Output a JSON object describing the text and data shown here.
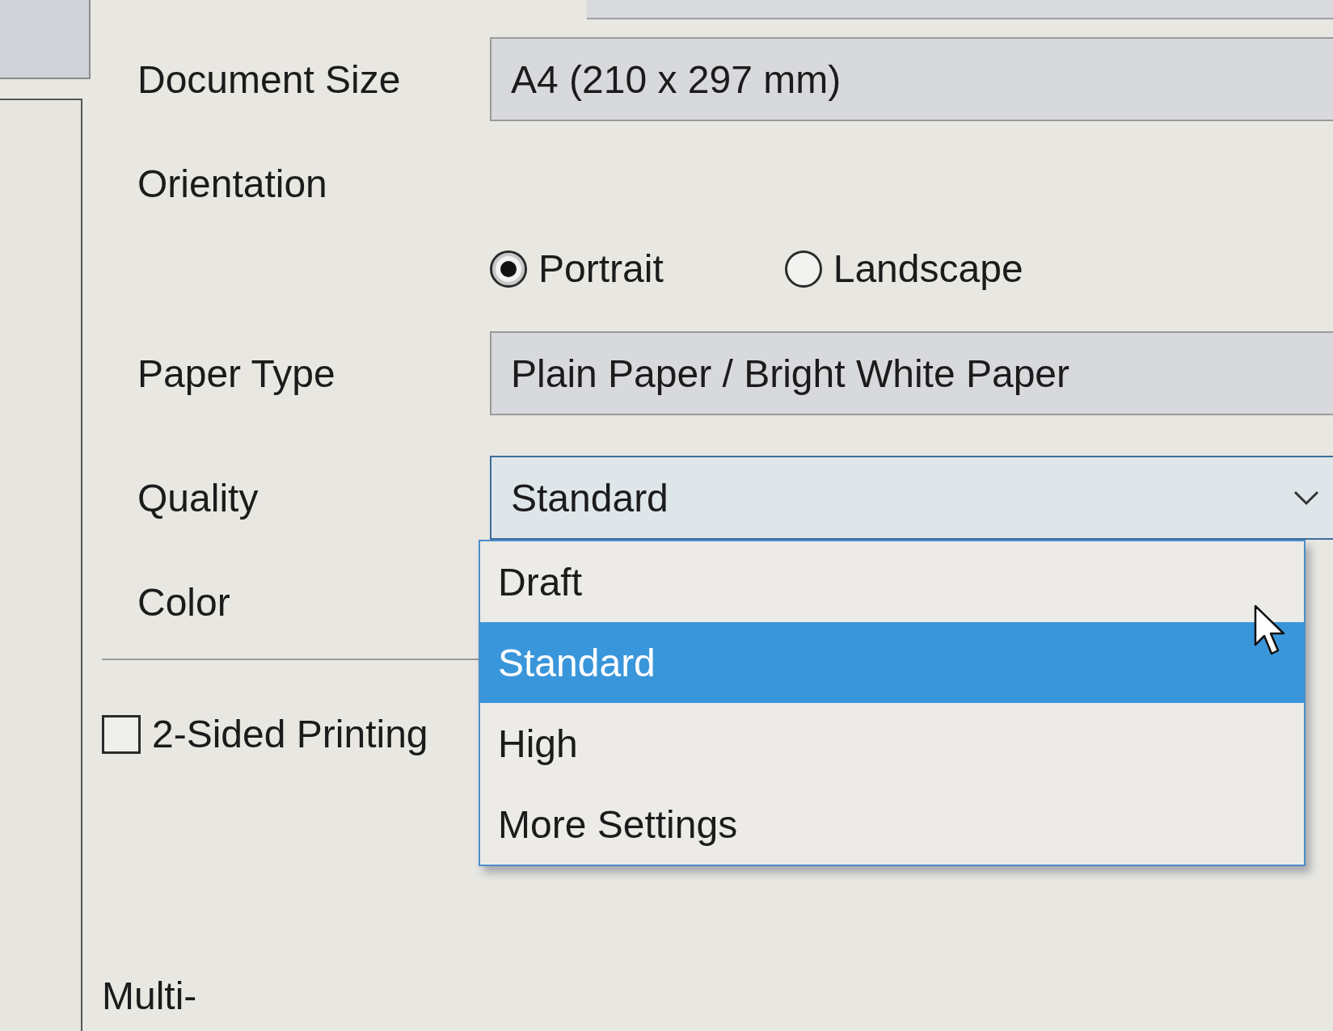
{
  "settings": [
    {
      "kind": "select",
      "label": "Document Size",
      "value": "A4 (210 x 297 mm)",
      "expanded": false
    },
    {
      "kind": "radio",
      "label": "Orientation",
      "options": [
        {
          "label": "Portrait",
          "selected": true
        },
        {
          "label": "Landscape",
          "selected": false
        }
      ]
    },
    {
      "kind": "select",
      "label": "Paper Type",
      "value": "Plain Paper / Bright White Paper",
      "expanded": false
    },
    {
      "kind": "select",
      "label": "Quality",
      "value": "Standard",
      "expanded": true,
      "options": [
        {
          "label": "Draft",
          "selected": false
        },
        {
          "label": "Standard",
          "selected": true
        },
        {
          "label": "High",
          "selected": false
        },
        {
          "label": "More Settings",
          "selected": false
        }
      ]
    },
    {
      "kind": "label",
      "label": "Color"
    }
  ],
  "two_sided": {
    "label": "2-Sided Printing",
    "checked": false
  },
  "bottom_label": "Multi-"
}
